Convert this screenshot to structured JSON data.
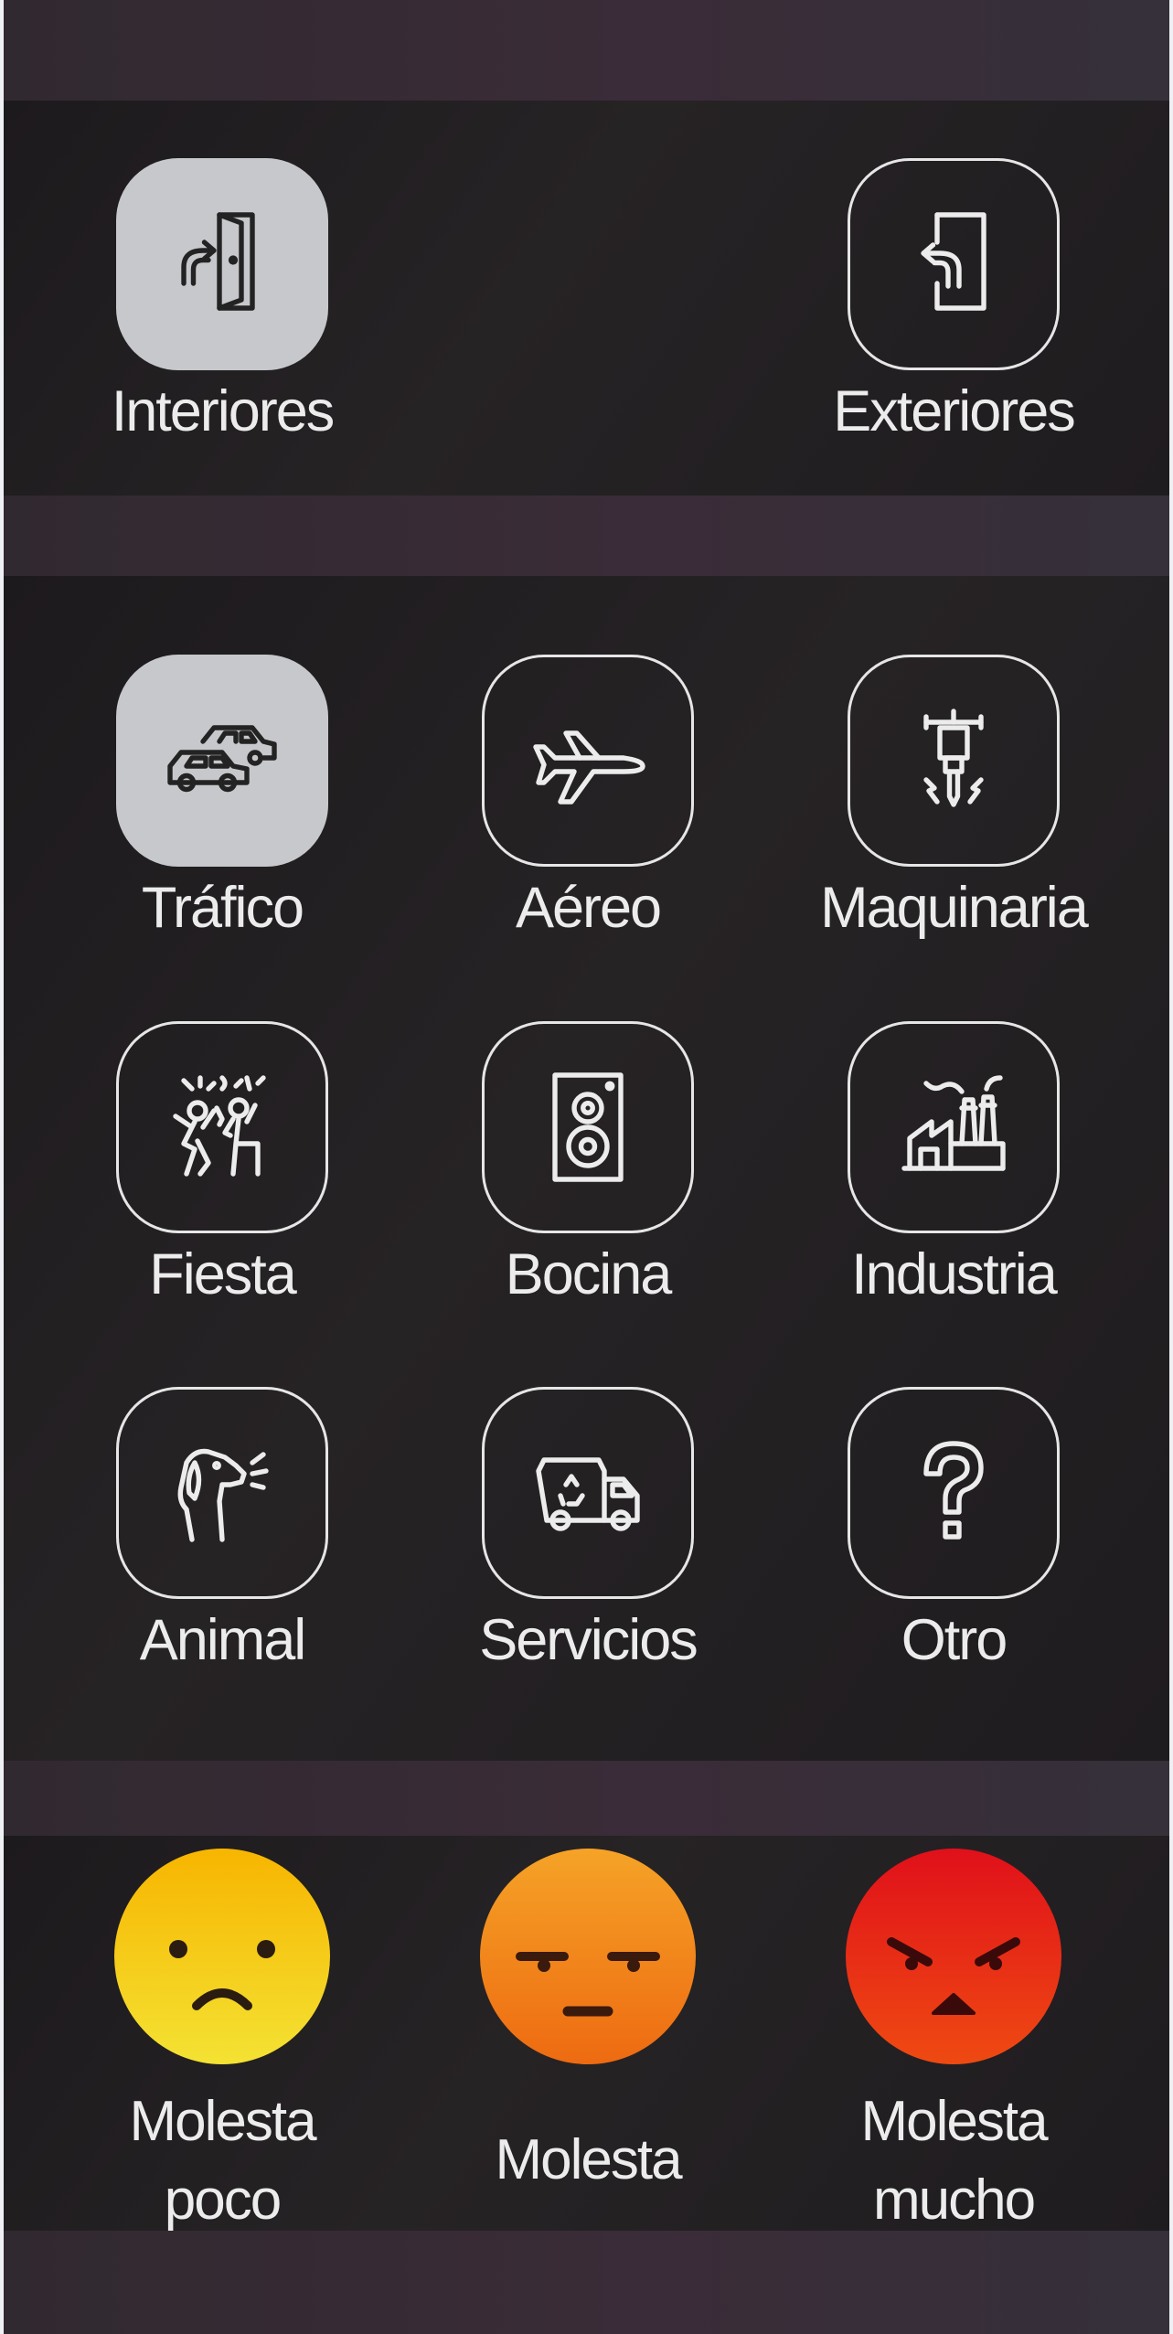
{
  "location": {
    "items": [
      {
        "label": "Interiores",
        "icon": "door-in-icon",
        "selected": true
      },
      {
        "label": "Exteriores",
        "icon": "door-out-icon",
        "selected": false
      }
    ]
  },
  "source": {
    "items": [
      {
        "label": "Tráfico",
        "icon": "cars-icon",
        "selected": true
      },
      {
        "label": "Aéreo",
        "icon": "airplane-icon",
        "selected": false
      },
      {
        "label": "Maquinaria",
        "icon": "jackhammer-icon",
        "selected": false
      },
      {
        "label": "Fiesta",
        "icon": "party-people-icon",
        "selected": false
      },
      {
        "label": "Bocina",
        "icon": "speaker-icon",
        "selected": false
      },
      {
        "label": "Industria",
        "icon": "factory-icon",
        "selected": false
      },
      {
        "label": "Animal",
        "icon": "barking-dog-icon",
        "selected": false
      },
      {
        "label": "Servicios",
        "icon": "garbage-truck-icon",
        "selected": false
      },
      {
        "label": "Otro",
        "icon": "question-mark-icon",
        "selected": false
      }
    ]
  },
  "annoyance": {
    "items": [
      {
        "line1": "Molesta",
        "line2": "poco",
        "icon": "sad-face-icon",
        "color_top": "#f7b500",
        "color_bottom": "#f4e233"
      },
      {
        "line1": "Molesta",
        "line2": "",
        "icon": "annoyed-face-icon",
        "color_top": "#f5a327",
        "color_bottom": "#ee6a11"
      },
      {
        "line1": "Molesta",
        "line2": "mucho",
        "icon": "angry-face-icon",
        "color_top": "#e0101a",
        "color_bottom": "#ef4a12"
      }
    ]
  },
  "colors": {
    "background": "#221f22",
    "band": "#3a2c38",
    "tile_border": "#e6e6e6",
    "tile_selected": "#c6c8cb"
  }
}
